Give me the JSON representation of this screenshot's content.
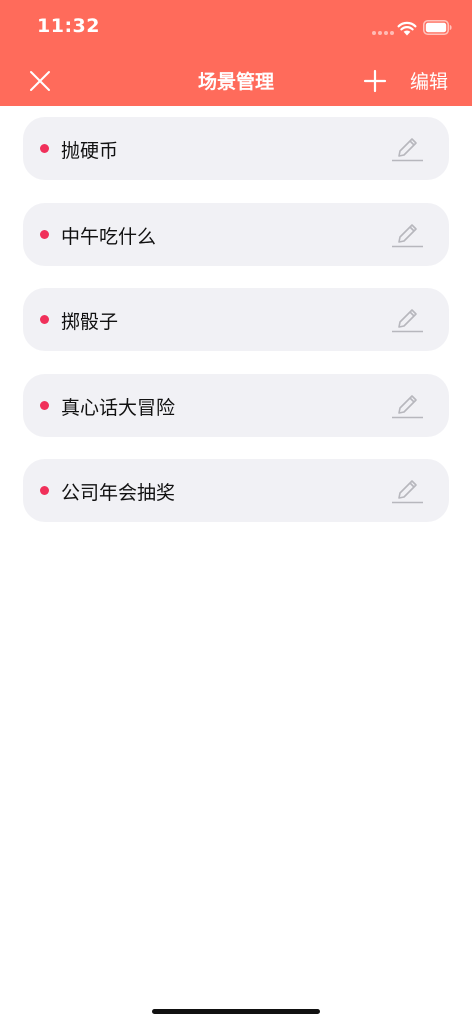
{
  "status_bar": {
    "time": "11:32",
    "icons": [
      "cellular-icon",
      "wifi-icon",
      "battery-icon"
    ]
  },
  "nav": {
    "title": "场景管理",
    "close_icon": "close-icon",
    "add_icon": "plus-icon",
    "edit_label": "编辑"
  },
  "colors": {
    "header_bg": "#ff6b5b",
    "card_bg": "#f1f1f5",
    "dot": "#f0305a",
    "edit_icon": "#b7b7bd"
  },
  "scenes": [
    {
      "name": "抛硬币",
      "icon": "pencil-icon"
    },
    {
      "name": "中午吃什么",
      "icon": "pencil-icon"
    },
    {
      "name": "掷骰子",
      "icon": "pencil-icon"
    },
    {
      "name": "真心话大冒险",
      "icon": "pencil-icon"
    },
    {
      "name": "公司年会抽奖",
      "icon": "pencil-icon"
    }
  ]
}
